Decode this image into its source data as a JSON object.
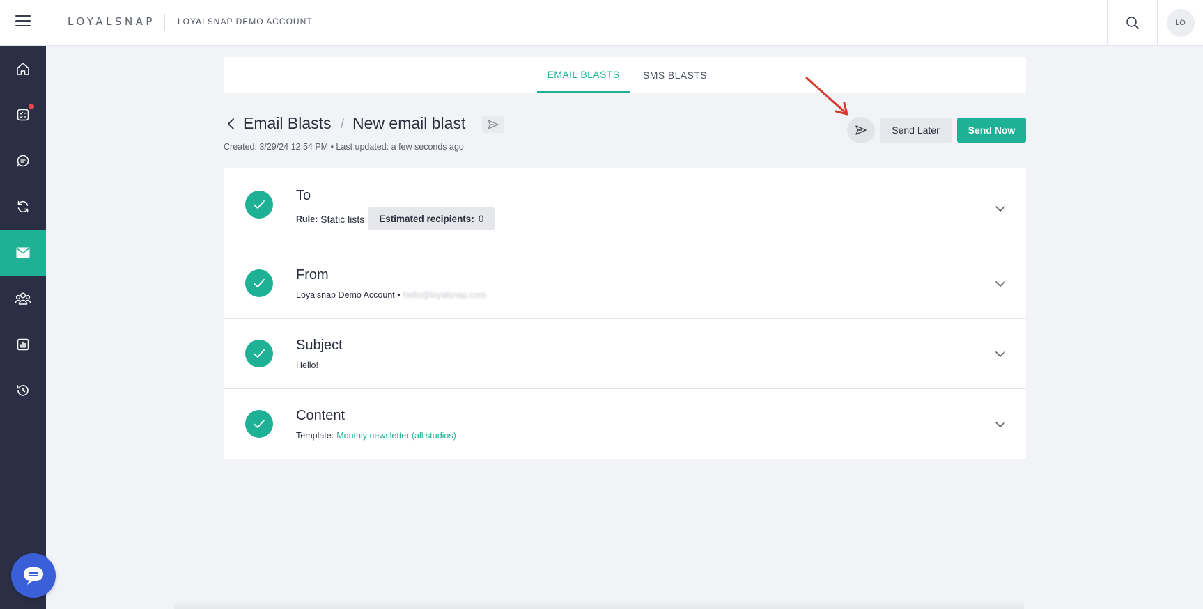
{
  "topbar": {
    "brand": "LOYALSNAP",
    "account": "LOYALSNAP DEMO ACCOUNT",
    "avatar_initials": "LO"
  },
  "sidebar": {
    "items": [
      {
        "name": "home",
        "icon": "home-icon"
      },
      {
        "name": "tasks",
        "icon": "checklist-icon",
        "notification": true
      },
      {
        "name": "messages",
        "icon": "chat-icon"
      },
      {
        "name": "automations",
        "icon": "refresh-icon"
      },
      {
        "name": "email",
        "icon": "mail-icon",
        "active": true
      },
      {
        "name": "members",
        "icon": "people-icon"
      },
      {
        "name": "reports",
        "icon": "bar-chart-icon"
      },
      {
        "name": "history",
        "icon": "history-icon"
      }
    ],
    "accent": "#1fb195",
    "background": "#2b2f45"
  },
  "tabs": {
    "email": "EMAIL BLASTS",
    "sms": "SMS BLASTS"
  },
  "header": {
    "breadcrumb_parent": "Email Blasts",
    "separator": "/",
    "title": "New email blast",
    "meta": "Created: 3/29/24 12:54 PM  •  Last updated: a few seconds ago"
  },
  "actions": {
    "send_later": "Send Later",
    "send_now": "Send Now"
  },
  "sections": {
    "to": {
      "title": "To",
      "rule_label": "Rule:",
      "rule_value": "Static lists",
      "recipients_label": "Estimated recipients:",
      "recipients_count": "0"
    },
    "from": {
      "title": "From",
      "sender": "Loyalsnap Demo Account •",
      "email_blurred": "hello@loyalsnap.com"
    },
    "subject": {
      "title": "Subject",
      "value": "Hello!"
    },
    "content": {
      "title": "Content",
      "template_label": "Template:",
      "template_value": "Monthly newsletter (all studios)"
    }
  }
}
